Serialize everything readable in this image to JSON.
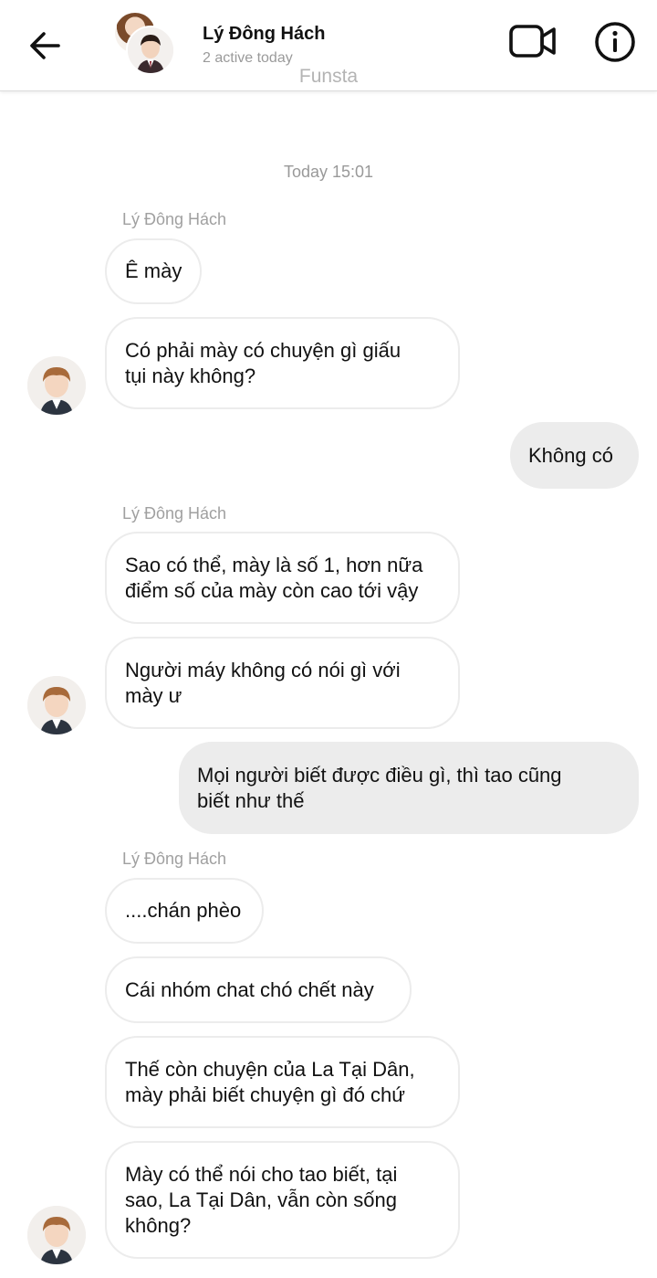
{
  "header": {
    "title": "Lý Đông Hách",
    "status": "2 active today",
    "watermark": "Funsta",
    "back_icon": "arrow-left-icon",
    "video_icon": "video-camera-icon",
    "info_icon": "info-icon"
  },
  "chat": {
    "timestamp": "Today 15:01",
    "sender_labels": [
      "Lý Đông Hách",
      "Lý Đông Hách",
      "Lý Đông Hách"
    ],
    "messages": [
      {
        "from": "other",
        "text": "Ê mày"
      },
      {
        "from": "other",
        "text": "Có phải mày có chuyện gì giấu\ntụi này không?"
      },
      {
        "from": "me",
        "text": "Không có"
      },
      {
        "from": "other",
        "text": "Sao có thể, mày là số 1, hơn nữa\nđiểm số của mày còn cao tới vậy"
      },
      {
        "from": "other",
        "text": "Người máy không có nói gì với\nmày ư"
      },
      {
        "from": "me",
        "text": "Mọi người biết được điều gì, thì tao cũng\nbiết như thế"
      },
      {
        "from": "other",
        "text": "....chán phèo"
      },
      {
        "from": "other",
        "text": "Cái nhóm chat chó chết này"
      },
      {
        "from": "other",
        "text": "Thế còn chuyện của La Tại Dân,\nmày phải biết chuyện gì đó chứ"
      },
      {
        "from": "other",
        "text": "Mày có thể nói cho tao biết, tại\nsao, La Tại Dân, vẫn còn sống\nkhông?"
      }
    ]
  },
  "colors": {
    "incoming_bubble_border": "#ececec",
    "outgoing_bubble_bg": "#ececec",
    "meta_text": "#999999"
  }
}
